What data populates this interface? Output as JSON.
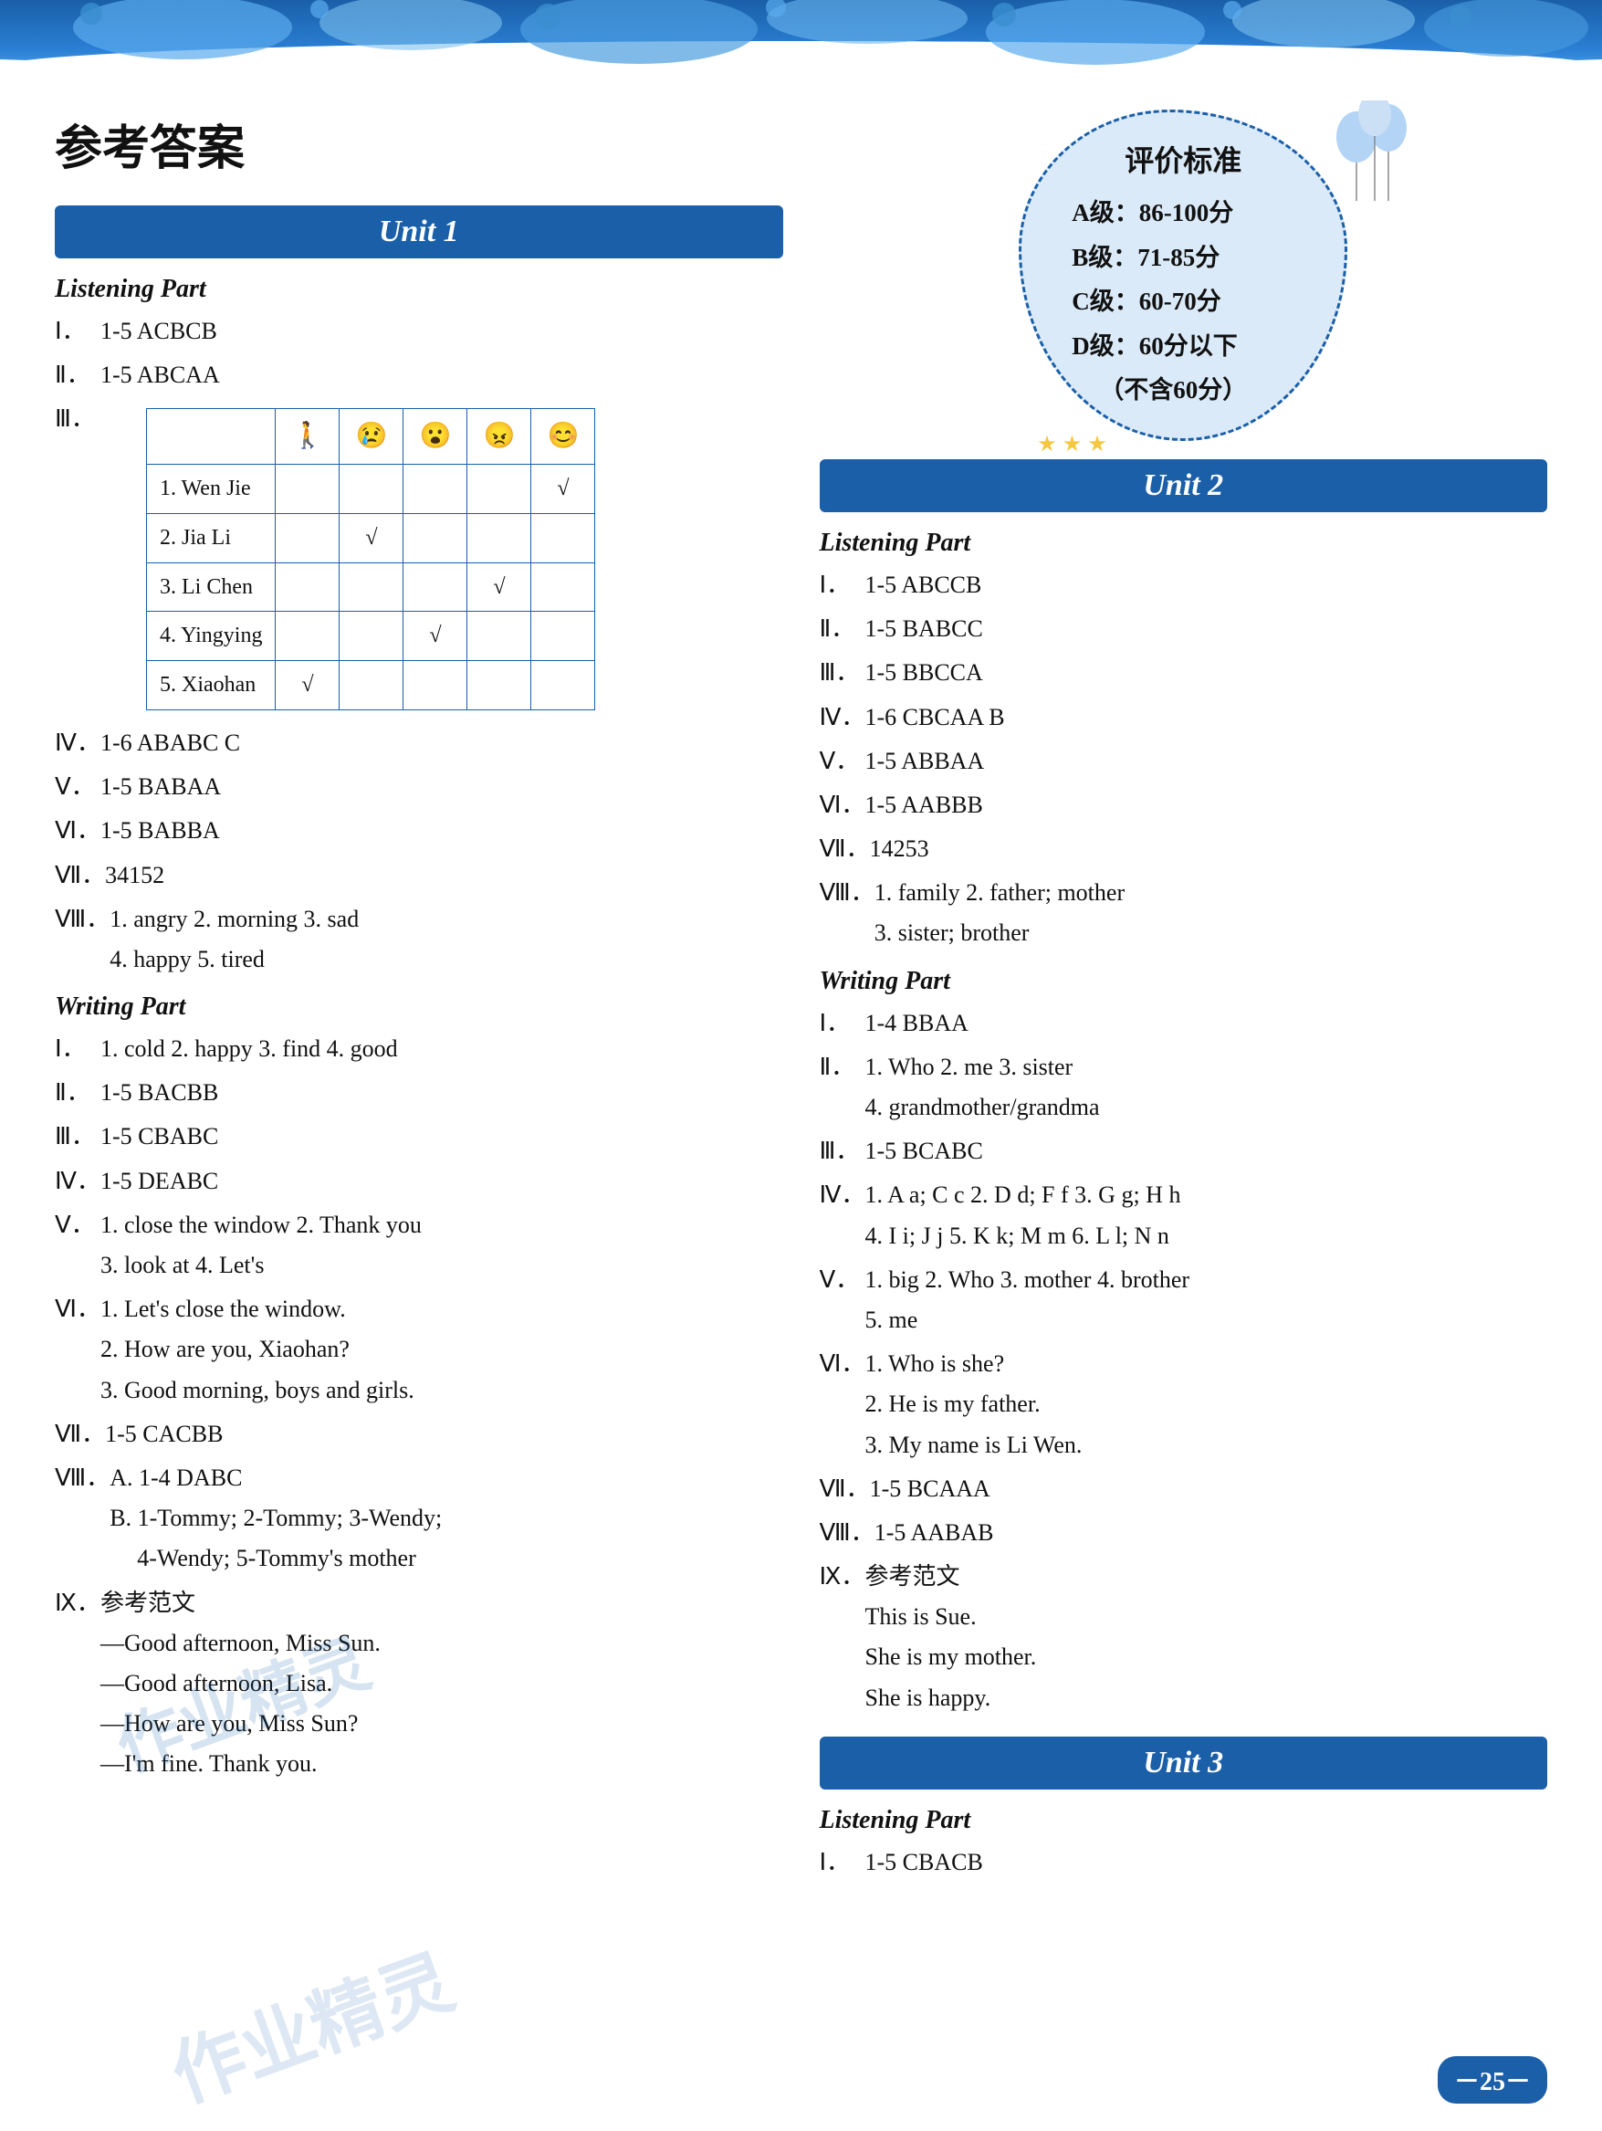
{
  "page": {
    "title": "参考答案",
    "number": "－25－"
  },
  "eval_box": {
    "title": "评价标准",
    "grades": [
      {
        "label": "A级：",
        "range": "86-100分"
      },
      {
        "label": "B级：",
        "range": "71-85分"
      },
      {
        "label": "C级：",
        "range": "60-70分"
      },
      {
        "label": "D级：",
        "range": "60分以下"
      },
      {
        "label": "",
        "range": "（不含60分）"
      }
    ]
  },
  "unit1": {
    "header": "Unit 1",
    "listening_part": "Listening Part",
    "sections": [
      {
        "roman": "Ⅰ．",
        "content": "1-5  ACBCB"
      },
      {
        "roman": "Ⅱ．",
        "content": "1-5  ABCAA"
      },
      {
        "roman": "Ⅲ．",
        "content": "table"
      },
      {
        "roman": "Ⅳ．",
        "content": "1-6  ABABC C"
      },
      {
        "roman": "Ⅴ．",
        "content": "1-5  BABAA"
      },
      {
        "roman": "Ⅵ．",
        "content": "1-5  BABBA"
      },
      {
        "roman": "Ⅶ．",
        "content": "34152"
      },
      {
        "roman": "Ⅷ．",
        "content": "1. angry   2. morning   3. sad\n4. happy   5. tired"
      }
    ],
    "table": {
      "headers": [
        "",
        "🚶",
        "😢",
        "😊",
        "😠",
        "😄"
      ],
      "rows": [
        {
          "name": "1. Wen Jie",
          "checks": [
            false,
            false,
            false,
            false,
            true
          ]
        },
        {
          "name": "2. Jia Li",
          "checks": [
            false,
            true,
            false,
            false,
            false
          ]
        },
        {
          "name": "3. Li Chen",
          "checks": [
            false,
            false,
            false,
            true,
            false
          ]
        },
        {
          "name": "4. Yingying",
          "checks": [
            false,
            false,
            true,
            false,
            false
          ]
        },
        {
          "name": "5. Xiaohan",
          "checks": [
            true,
            false,
            false,
            false,
            false
          ]
        }
      ]
    },
    "writing_part": "Writing Part",
    "writing_sections": [
      {
        "roman": "Ⅰ．",
        "content": "1. cold   2. happy   3. find   4. good"
      },
      {
        "roman": "Ⅱ．",
        "content": "1-5  BACBB"
      },
      {
        "roman": "Ⅲ．",
        "content": "1-5  CBABC"
      },
      {
        "roman": "Ⅳ．",
        "content": "1-5  DEABC"
      },
      {
        "roman": "Ⅴ．",
        "content": "1. close the window   2. Thank you\n3. look at   4. Let's"
      },
      {
        "roman": "Ⅵ．",
        "content": "1. Let's close the window.\n2. How are you, Xiaohan?\n3. Good morning, boys and girls."
      },
      {
        "roman": "Ⅶ．",
        "content": "1-5  CACBB"
      },
      {
        "roman": "Ⅷ．",
        "content": "A. 1-4  DABC\nB. 1-Tommy; 2-Tommy; 3-Wendy;\n4-Wendy; 5-Tommy's mother"
      },
      {
        "roman": "Ⅸ．",
        "content": "参考范文\n—Good afternoon, Miss Sun.\n—Good afternoon, Lisa.\n—How are you, Miss Sun?\n—I'm fine. Thank you."
      }
    ]
  },
  "unit2": {
    "header": "Unit 2",
    "listening_part": "Listening Part",
    "sections": [
      {
        "roman": "Ⅰ．",
        "content": "1-5  ABCCB"
      },
      {
        "roman": "Ⅱ．",
        "content": "1-5  BABCC"
      },
      {
        "roman": "Ⅲ．",
        "content": "1-5  BBCCA"
      },
      {
        "roman": "Ⅳ．",
        "content": "1-6  CBCAA B"
      },
      {
        "roman": "Ⅴ．",
        "content": "1-5  ABBAA"
      },
      {
        "roman": "Ⅵ．",
        "content": "1-5  AABBB"
      },
      {
        "roman": "Ⅶ．",
        "content": "14253"
      },
      {
        "roman": "Ⅷ．",
        "content": "1. family   2. father; mother\n3. sister; brother"
      }
    ],
    "writing_part": "Writing Part",
    "writing_sections": [
      {
        "roman": "Ⅰ．",
        "content": "1-4  BBAA"
      },
      {
        "roman": "Ⅱ．",
        "content": "1. Who   2. me   3. sister\n4. grandmother/grandma"
      },
      {
        "roman": "Ⅲ．",
        "content": "1-5  BCABC"
      },
      {
        "roman": "Ⅳ．",
        "content": "1. A a; C c   2. D d; F f   3. G g; H h\n4. I i; J j   5. K k; M m   6. L l; N n"
      },
      {
        "roman": "Ⅴ．",
        "content": "1. big   2. Who   3. mother   4. brother\n5. me"
      },
      {
        "roman": "Ⅵ．",
        "content": "1. Who is she?\n2. He is my father.\n3. My name is Li Wen."
      },
      {
        "roman": "Ⅶ．",
        "content": "1-5  BCAAA"
      },
      {
        "roman": "Ⅷ．",
        "content": "1-5  AABAB"
      },
      {
        "roman": "Ⅸ．",
        "content": "参考范文\nThis is Sue.\nShe is my mother.\nShe is happy."
      }
    ]
  },
  "unit3": {
    "header": "Unit 3",
    "listening_part": "Listening Part",
    "sections": [
      {
        "roman": "Ⅰ．",
        "content": "1-5  CBACB"
      }
    ]
  },
  "watermarks": [
    "作业精灵",
    "作业精灵"
  ]
}
